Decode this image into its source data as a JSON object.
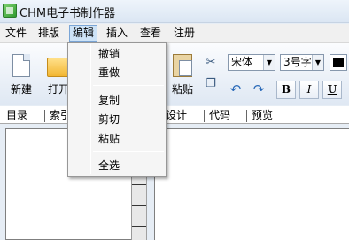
{
  "window": {
    "title": "CHM电子书制作器"
  },
  "menubar": {
    "items": [
      {
        "label": "文件"
      },
      {
        "label": "排版"
      },
      {
        "label": "编辑"
      },
      {
        "label": "插入"
      },
      {
        "label": "查看"
      },
      {
        "label": "注册"
      }
    ]
  },
  "toolbar": {
    "new_label": "新建",
    "open_label": "打开",
    "paste_label": "粘贴",
    "font_name": "宋体",
    "font_size": "3号字",
    "bold": "B",
    "italic": "I",
    "underline": "U"
  },
  "tabs": {
    "left": [
      "目录",
      "索引"
    ],
    "right": [
      "设计",
      "代码",
      "预览"
    ]
  },
  "edit_menu": {
    "items": [
      {
        "label": "撤销"
      },
      {
        "label": "重做"
      },
      {
        "label": "复制"
      },
      {
        "label": "剪切"
      },
      {
        "label": "粘贴"
      },
      {
        "label": "全选"
      }
    ]
  }
}
